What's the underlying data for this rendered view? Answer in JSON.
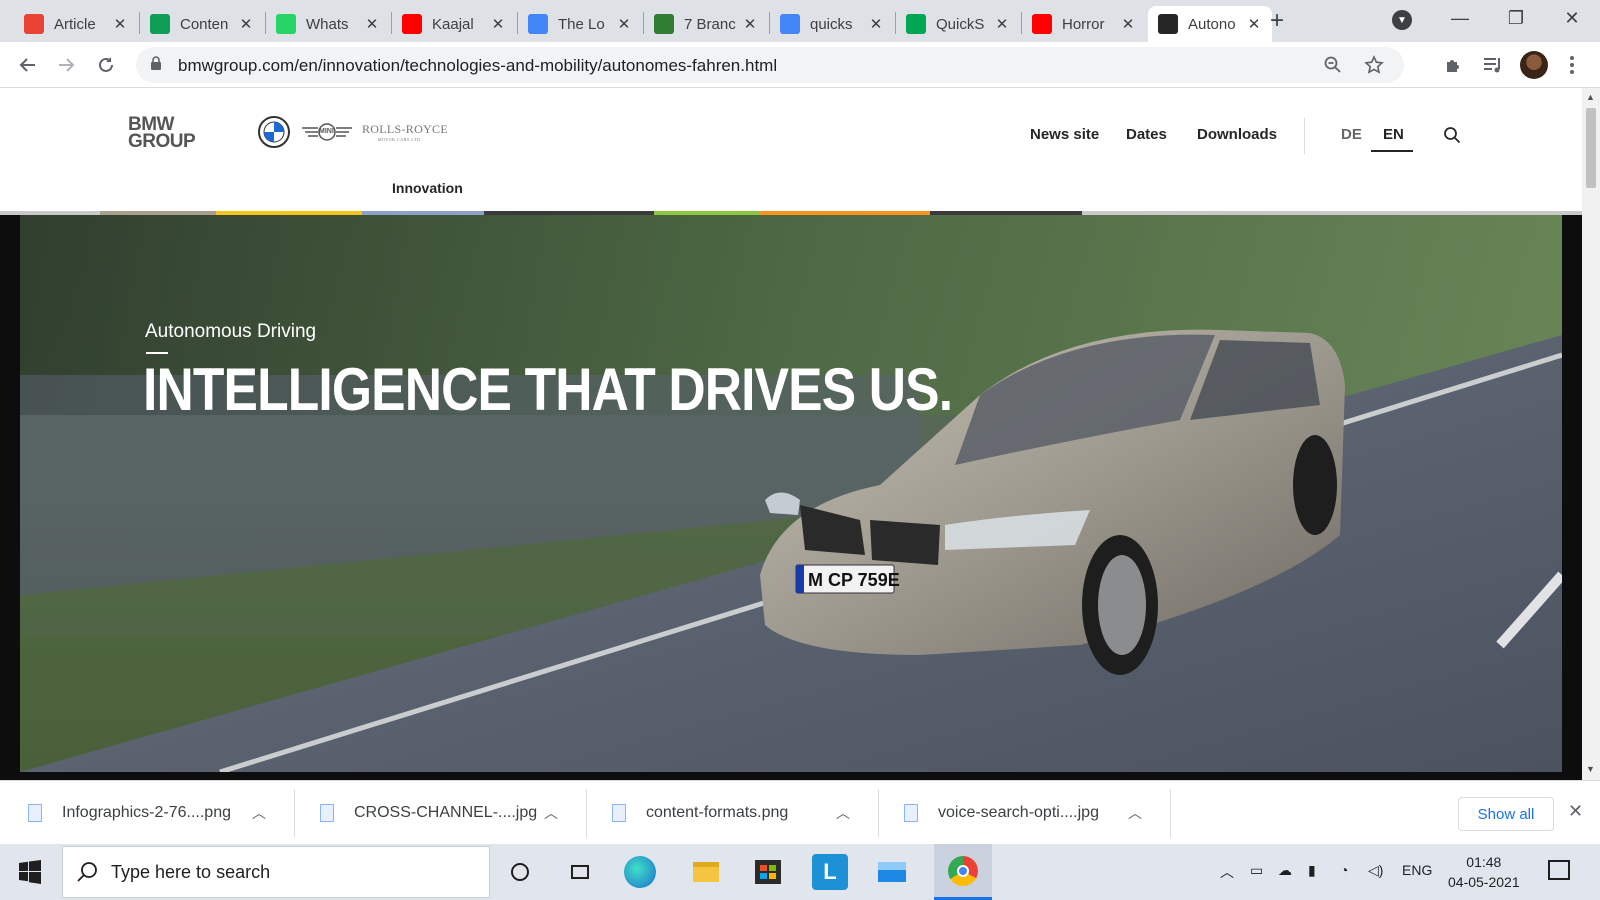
{
  "browser": {
    "tabs": [
      {
        "title": "Article",
        "favicon": "gmail-icon",
        "color": "#ea4335"
      },
      {
        "title": "Conten",
        "favicon": "sheets-icon",
        "color": "#0f9d58"
      },
      {
        "title": "Whats",
        "favicon": "whatsapp-icon",
        "color": "#25d366"
      },
      {
        "title": "Kaajal",
        "favicon": "youtube-icon",
        "color": "#ff0000"
      },
      {
        "title": "The Lo",
        "favicon": "docs-icon",
        "color": "#4285f4"
      },
      {
        "title": "7 Branc",
        "favicon": "leaf-icon",
        "color": "#2e7d32"
      },
      {
        "title": "quicks",
        "favicon": "google-icon",
        "color": "#4285f4"
      },
      {
        "title": "QuickS",
        "favicon": "quicksprout-icon",
        "color": "#00a651"
      },
      {
        "title": "Horror",
        "favicon": "youtube-icon",
        "color": "#ff0000"
      },
      {
        "title": "Autono",
        "favicon": "bmw-group-icon",
        "color": "#262626"
      }
    ],
    "url": "bmwgroup.com/en/innovation/technologies-and-mobility/autonomes-fahren.html"
  },
  "site": {
    "logo_line1": "BMW",
    "logo_line2": "GROUP",
    "brand_rr": "ROLLS-ROYCE",
    "brand_rr_sub": "MOTOR CARS LTD",
    "brand_mini": "MINI",
    "nav": {
      "news": "News site",
      "dates": "Dates",
      "downloads": "Downloads"
    },
    "lang": {
      "de": "DE",
      "en": "EN",
      "active": "EN"
    },
    "section": "Innovation",
    "strip_colors": [
      "#c9c9c9",
      "#a99f8f",
      "#f5c518",
      "#8ca0c8",
      "#3a3a3a",
      "#8dc63f",
      "#f7941d",
      "#3a3a3a",
      "#c9c9c9"
    ]
  },
  "hero": {
    "eyebrow": "Autonomous Driving",
    "title": "INTELLIGENCE THAT DRIVES US.",
    "plate": "M CP 759E"
  },
  "downloads": {
    "items": [
      {
        "name": "Infographics-2-76....png"
      },
      {
        "name": "CROSS-CHANNEL-....jpg"
      },
      {
        "name": "content-formats.png"
      },
      {
        "name": "voice-search-opti....jpg"
      }
    ],
    "show_all": "Show all"
  },
  "taskbar": {
    "search_placeholder": "Type here to search",
    "lang": "ENG",
    "time": "01:48",
    "date": "04-05-2021"
  }
}
